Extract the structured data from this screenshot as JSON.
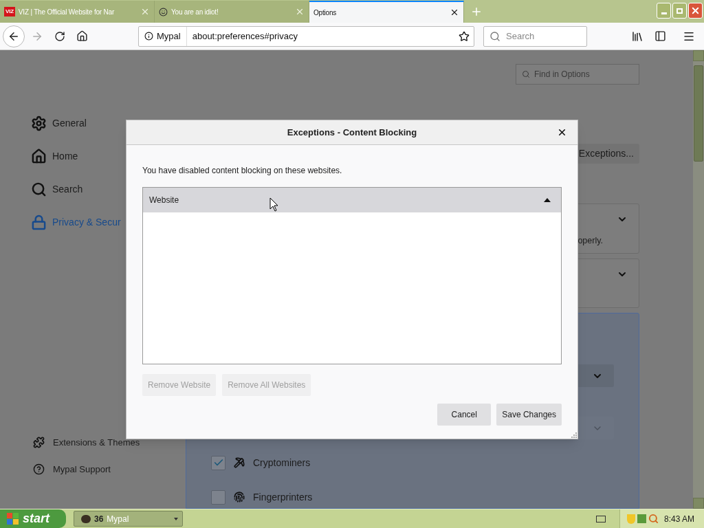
{
  "tabs": [
    {
      "kind": "logo",
      "logo_text": "VIZ",
      "title": "VIZ | The Official Website for Nar",
      "selected": false
    },
    {
      "kind": "emoji",
      "title": "You are an idiot!",
      "selected": false
    },
    {
      "kind": "plain",
      "title": "Options",
      "selected": true
    }
  ],
  "toolbar": {
    "forward_disabled": true,
    "identity": "Mypal",
    "url": "about:preferences#privacy",
    "search_placeholder": "Search"
  },
  "page": {
    "find_placeholder": "Find in Options",
    "sidebar": [
      {
        "kind": "gear",
        "label": "General",
        "selected": false
      },
      {
        "kind": "home",
        "label": "Home",
        "selected": false
      },
      {
        "kind": "search",
        "label": "Search",
        "selected": false
      },
      {
        "kind": "lock",
        "label": "Privacy & Secur",
        "selected": true
      }
    ],
    "footer": [
      {
        "kind": "puzzle",
        "label": "Extensions & Themes"
      },
      {
        "kind": "help",
        "label": "Mypal Support"
      }
    ],
    "exceptions_button": "Exceptions...",
    "card_text": "operly.",
    "trackers": [
      {
        "kind": "miner",
        "label": "Cryptominers",
        "checked": true
      },
      {
        "kind": "fingerprint",
        "label": "Fingerprinters",
        "checked": false
      }
    ]
  },
  "dialog": {
    "title": "Exceptions - Content Blocking",
    "message": "You have disabled content blocking on these websites.",
    "column": "Website",
    "actions": [
      {
        "label": "Remove Website",
        "disabled": true
      },
      {
        "label": "Remove All Websites",
        "disabled": true
      }
    ],
    "buttons": [
      {
        "label": "Cancel",
        "disabled": false
      },
      {
        "label": "Save Changes",
        "disabled": false
      }
    ]
  },
  "taskbar": {
    "start": "start",
    "task_count": "36",
    "task_label": "Mypal",
    "clock": "8:43 AM"
  }
}
